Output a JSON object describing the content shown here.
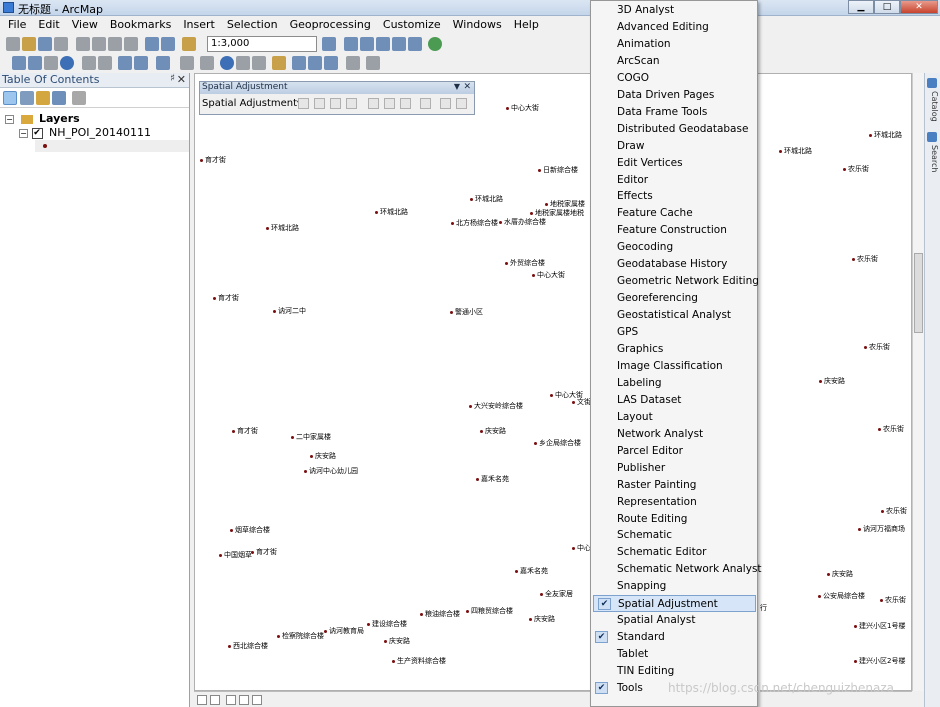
{
  "window": {
    "title": "无标题 - ArcMap"
  },
  "menubar": [
    "File",
    "Edit",
    "View",
    "Bookmarks",
    "Insert",
    "Selection",
    "Geoprocessing",
    "Customize",
    "Windows",
    "Help"
  ],
  "toolbar": {
    "scale": "1:3,000"
  },
  "toc": {
    "title": "Table Of Contents",
    "root": "Layers",
    "layer": "NH_POI_20140111"
  },
  "spatial_adjustment_toolbar": {
    "title": "Spatial Adjustment",
    "dropdown": "Spatial Adjustment▾"
  },
  "map_labels": [
    "中心大街",
    "环城北路",
    "环城北路",
    "农乐街",
    "育才街",
    "日新综合楼",
    "环城北路",
    "地税家属楼",
    "环城北路",
    "环城北路",
    "北方杨综合楼",
    "水厝办综合楼",
    "地税家属楼地税",
    "外贸综合楼",
    "中心大街",
    "农乐街",
    "育才街",
    "讷河二中",
    "警通小区",
    "农乐街",
    "庆安路",
    "中心大街",
    "大兴安岭综合楼",
    "文街",
    "育才街",
    "二中家属楼",
    "庆安路",
    "乡企局综合楼",
    "农乐街",
    "庆安路",
    "讷河中心幼儿园",
    "嘉禾名苑",
    "农乐街",
    "讷河万福商场",
    "烟草综合楼",
    "中心",
    "育才街",
    "中国烟草",
    "嘉禾名苑",
    "庆安路",
    "全友家居",
    "公安局综合楼",
    "农乐街",
    "西北综合楼",
    "检察院综合楼",
    "讷河教育局",
    "建设综合楼",
    "粮油综合楼",
    "四粮贸综合楼",
    "庆安路",
    "行",
    "建兴小区1号楼",
    "庆安路",
    "生产资料综合楼",
    "建兴小区2号楼"
  ],
  "toolbars_menu": {
    "items": [
      {
        "label": "3D Analyst",
        "checked": false
      },
      {
        "label": "Advanced Editing",
        "checked": false
      },
      {
        "label": "Animation",
        "checked": false
      },
      {
        "label": "ArcScan",
        "checked": false
      },
      {
        "label": "COGO",
        "checked": false
      },
      {
        "label": "Data Driven Pages",
        "checked": false
      },
      {
        "label": "Data Frame Tools",
        "checked": false
      },
      {
        "label": "Distributed Geodatabase",
        "checked": false
      },
      {
        "label": "Draw",
        "checked": false
      },
      {
        "label": "Edit Vertices",
        "checked": false
      },
      {
        "label": "Editor",
        "checked": false
      },
      {
        "label": "Effects",
        "checked": false
      },
      {
        "label": "Feature Cache",
        "checked": false
      },
      {
        "label": "Feature Construction",
        "checked": false
      },
      {
        "label": "Geocoding",
        "checked": false
      },
      {
        "label": "Geodatabase History",
        "checked": false
      },
      {
        "label": "Geometric Network Editing",
        "checked": false
      },
      {
        "label": "Georeferencing",
        "checked": false
      },
      {
        "label": "Geostatistical Analyst",
        "checked": false
      },
      {
        "label": "GPS",
        "checked": false
      },
      {
        "label": "Graphics",
        "checked": false
      },
      {
        "label": "Image Classification",
        "checked": false
      },
      {
        "label": "Labeling",
        "checked": false
      },
      {
        "label": "LAS Dataset",
        "checked": false
      },
      {
        "label": "Layout",
        "checked": false
      },
      {
        "label": "Network Analyst",
        "checked": false
      },
      {
        "label": "Parcel Editor",
        "checked": false
      },
      {
        "label": "Publisher",
        "checked": false
      },
      {
        "label": "Raster Painting",
        "checked": false
      },
      {
        "label": "Representation",
        "checked": false
      },
      {
        "label": "Route Editing",
        "checked": false
      },
      {
        "label": "Schematic",
        "checked": false
      },
      {
        "label": "Schematic Editor",
        "checked": false
      },
      {
        "label": "Schematic Network Analyst",
        "checked": false
      },
      {
        "label": "Snapping",
        "checked": false
      },
      {
        "label": "Spatial Adjustment",
        "checked": true,
        "highlighted": true
      },
      {
        "label": "Spatial Analyst",
        "checked": false
      },
      {
        "label": "Standard",
        "checked": true
      },
      {
        "label": "Tablet",
        "checked": false
      },
      {
        "label": "TIN Editing",
        "checked": false
      },
      {
        "label": "Tools",
        "checked": true
      }
    ]
  },
  "side_tabs": [
    "Catalog",
    "Search"
  ],
  "watermark": "https://blog.csdn.net/chenguizhenaza",
  "check_glyph": "✔"
}
